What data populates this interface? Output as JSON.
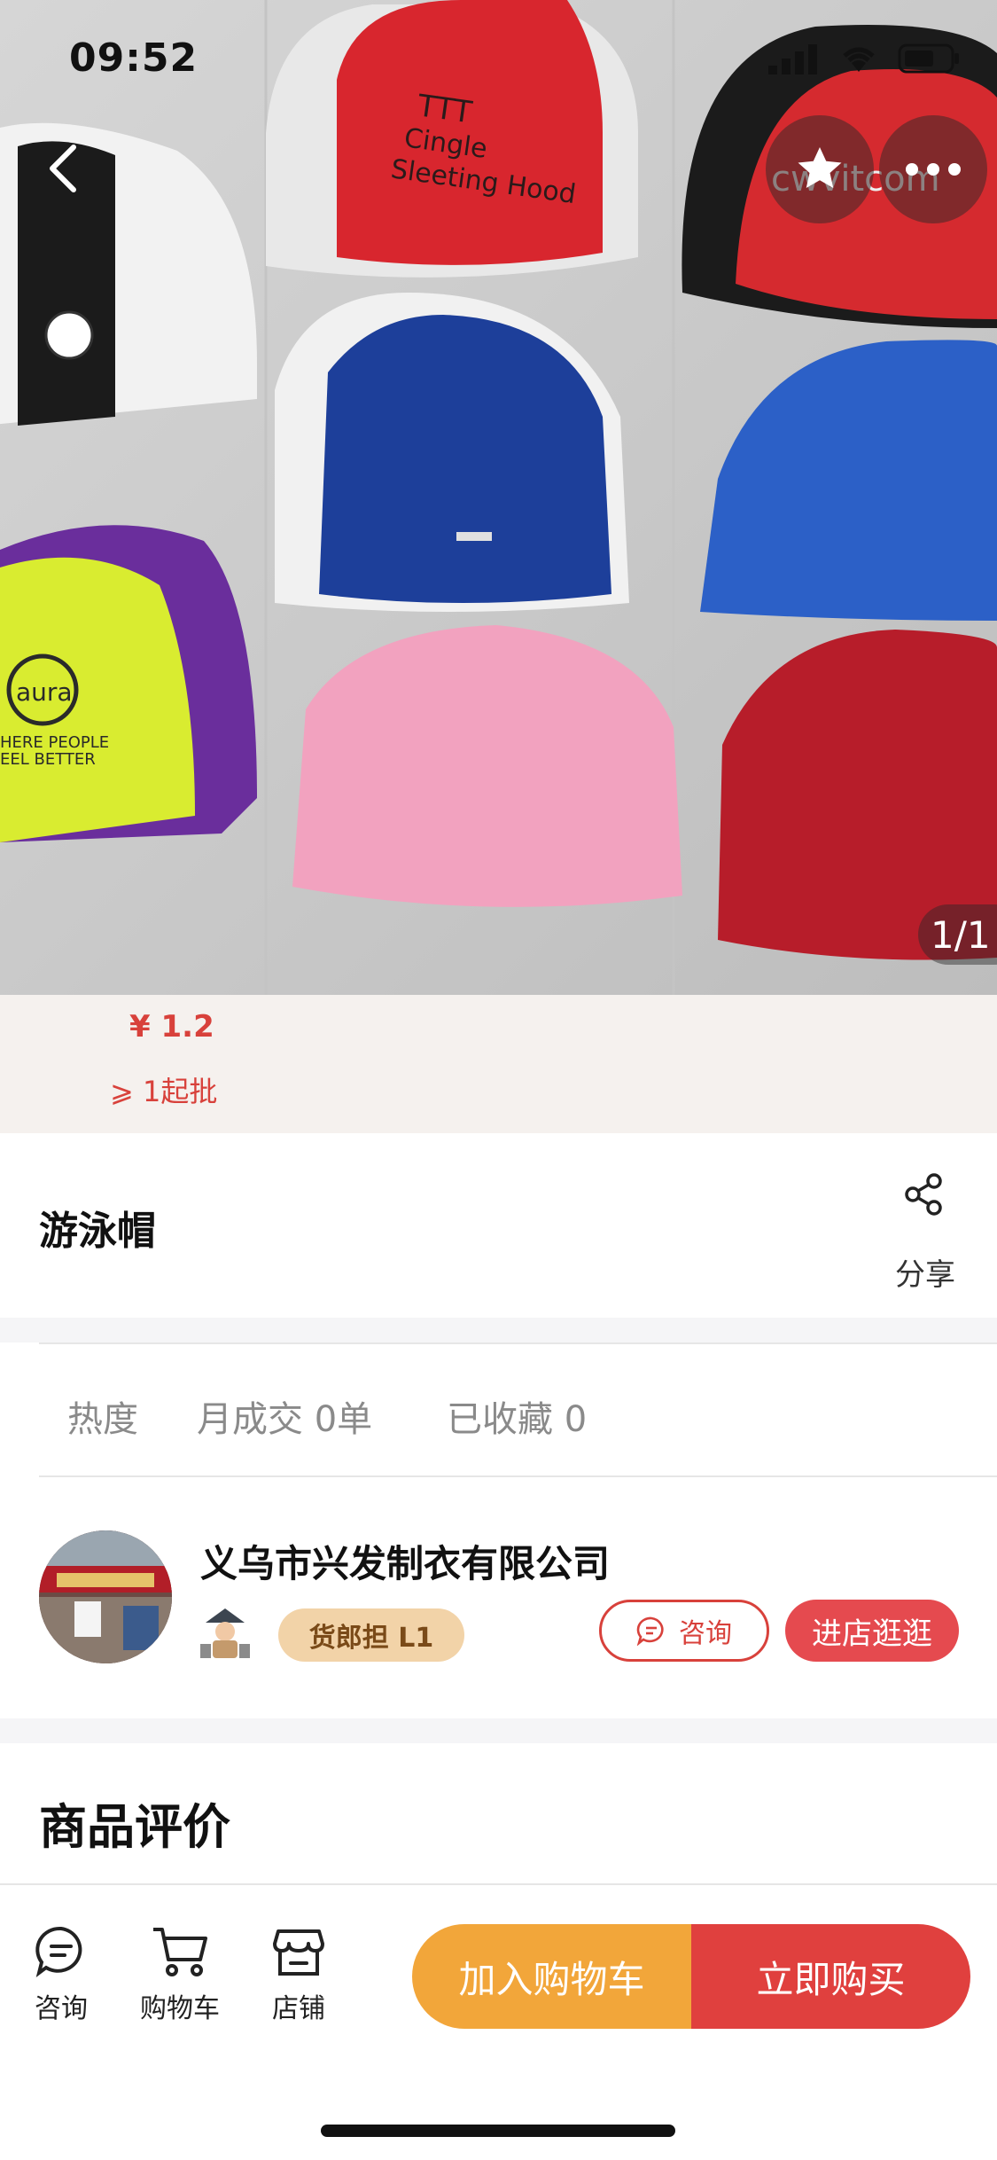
{
  "status_bar": {
    "time": "09:52"
  },
  "gallery": {
    "indicator": "1/1"
  },
  "price": {
    "amount": "¥ 1.2",
    "moq": "⩾ 1起批"
  },
  "product": {
    "title": "游泳帽",
    "share_label": "分享"
  },
  "stats": {
    "heat_label": "热度",
    "monthly_sales": "月成交 0单",
    "favorites": "已收藏 0"
  },
  "shop": {
    "name": "义乌市兴发制衣有限公司",
    "level": "货郎担 L1",
    "consult_label": "咨询",
    "visit_label": "进店逛逛"
  },
  "reviews": {
    "title": "商品评价"
  },
  "bottom_bar": {
    "consult": "咨询",
    "cart": "购物车",
    "store": "店铺",
    "add_to_cart": "加入购物车",
    "buy_now": "立即购买"
  },
  "colors": {
    "accent_red": "#e0403e",
    "accent_orange": "#f2a63a",
    "price_red": "#d8413b"
  },
  "icons": [
    "back-icon",
    "star-icon",
    "more-icon",
    "share-icon",
    "chat-icon",
    "cart-icon",
    "store-icon",
    "signal-icon",
    "wifi-icon",
    "battery-icon"
  ]
}
